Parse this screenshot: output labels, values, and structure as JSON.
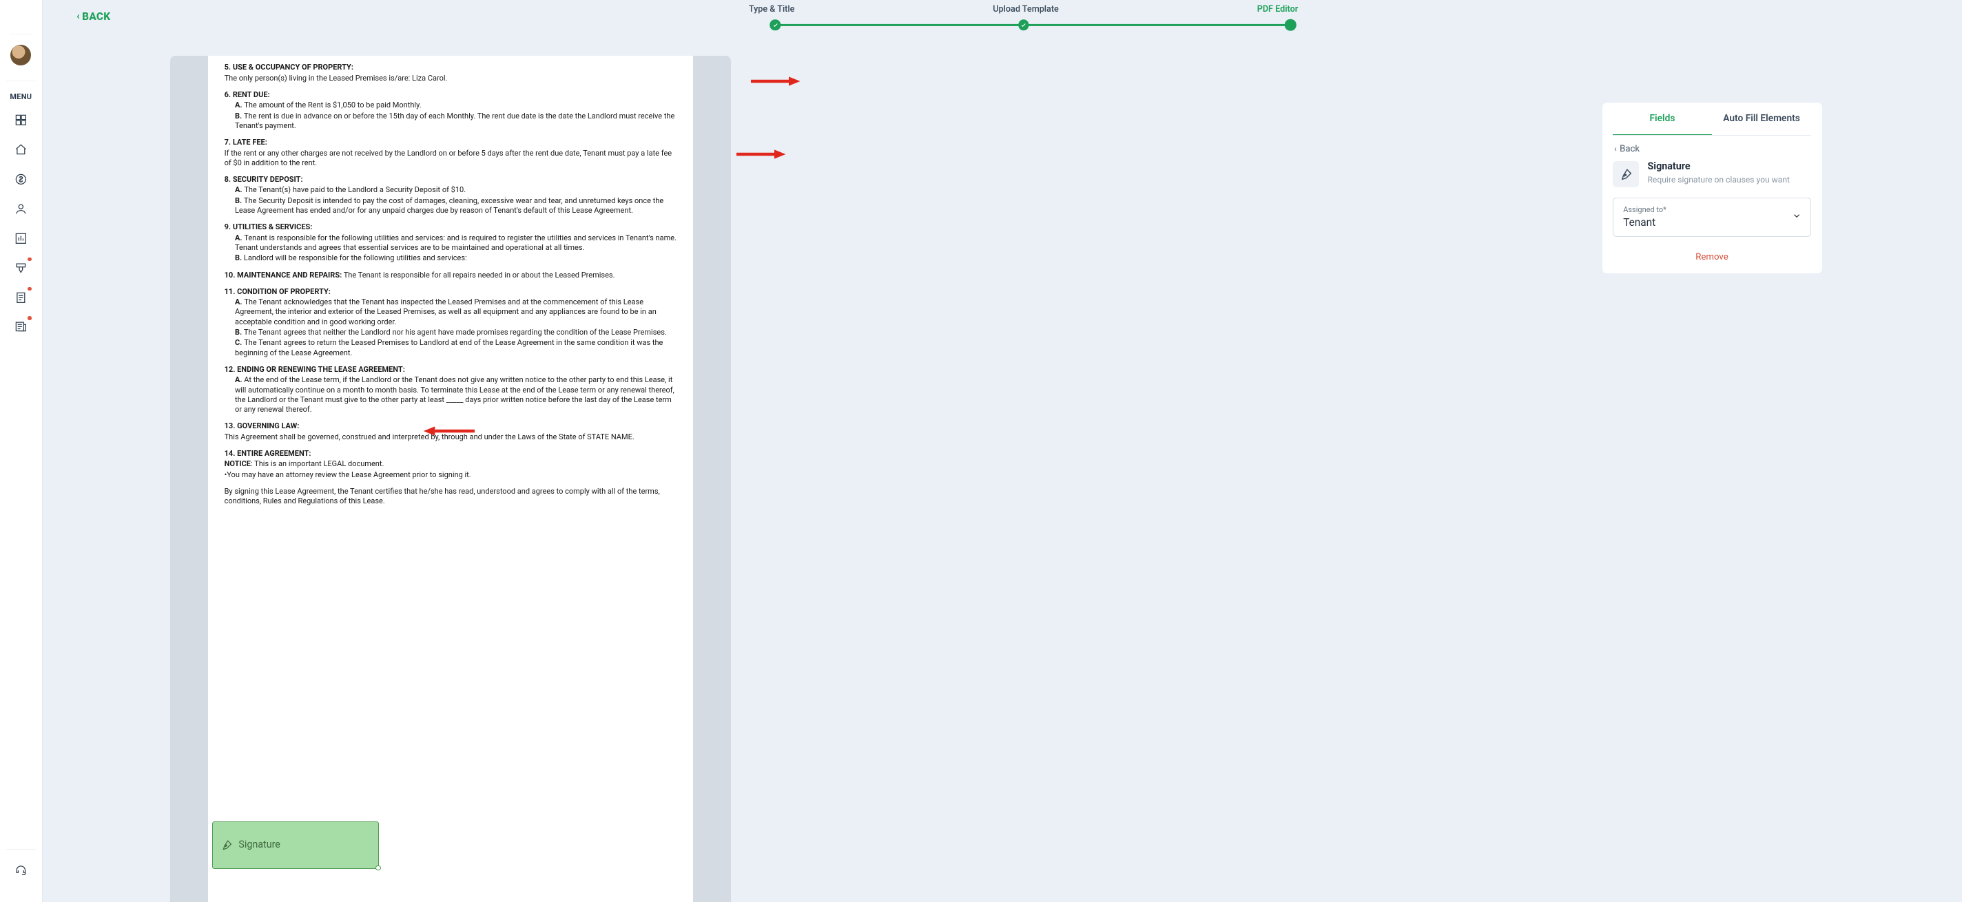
{
  "sidebar": {
    "menu_label": "MENU",
    "items": [
      {
        "name": "dashboard-icon"
      },
      {
        "name": "home-icon"
      },
      {
        "name": "money-icon"
      },
      {
        "name": "person-icon"
      },
      {
        "name": "chart-icon"
      },
      {
        "name": "brush-icon",
        "dot": true
      },
      {
        "name": "document-icon",
        "dot": true
      },
      {
        "name": "news-icon",
        "dot": true
      }
    ],
    "footer_icon": "headset-icon"
  },
  "header": {
    "back_label": "BACK",
    "steps": [
      "Type & Title",
      "Upload Template",
      "PDF Editor"
    ],
    "active_step_index": 2
  },
  "document": {
    "sec5_title": "5. USE & OCCUPANCY OF PROPERTY:",
    "sec5_body": "The only person(s) living in the Leased Premises is/are: Liza Carol.",
    "sec6_title": "6. RENT DUE:",
    "sec6_a": "The amount of the Rent is $1,050 to be paid Monthly.",
    "sec6_b": "The rent is due in advance on or before the 15th day of each Monthly. The rent due date is the date the Landlord must receive the Tenant's payment.",
    "sec7_title": "7. LATE FEE:",
    "sec7_body": "If the rent or any other charges are not received by the Landlord on or before 5 days after the rent due date, Tenant must pay a late fee of  $0 in addition to the rent.",
    "sec8_title": "8. SECURITY DEPOSIT:",
    "sec8_a": "The Tenant(s) have paid to the Landlord a Security Deposit of $10.",
    "sec8_b": "The Security Deposit is intended to pay the cost of damages, cleaning, excessive wear and tear, and unreturned keys once the Lease Agreement has ended and/or for any unpaid charges due by reason of Tenant's default of this Lease Agreement.",
    "sec9_title": "9. UTILITIES & SERVICES:",
    "sec9_a": "Tenant is responsible for the following utilities and services:  and is required to register the utilities and services in Tenant's name. Tenant understands and agrees that essential services are to be maintained and operational at all times.",
    "sec9_b": "Landlord will be responsible for the following utilities and services:",
    "sec10_title": "10. MAINTENANCE AND REPAIRS:",
    "sec10_body": "The Tenant is responsible for all repairs needed in or about the Leased Premises.",
    "sec11_title": "11. CONDITION OF PROPERTY:",
    "sec11_a": "The Tenant acknowledges that the Tenant has inspected the Leased Premises and at the commencement of this Lease Agreement, the interior and exterior of the Leased Premises, as well as all equipment and any appliances are found to be in an acceptable condition and in good working order.",
    "sec11_b": "The Tenant agrees that neither the Landlord nor his agent have made promises regarding the condition of the Lease Premises.",
    "sec11_c": "The Tenant agrees to return the Leased Premises to Landlord at end of the Lease Agreement in the same condition it was the beginning of the Lease Agreement.",
    "sec12_title": "12. ENDING OR RENEWING THE LEASE AGREEMENT:",
    "sec12_a": "At the end of the Lease term, if the Landlord or the Tenant does not give any written notice to the other party to end this Lease, it will automatically continue on a month to month basis. To terminate this Lease at the end of the Lease term or any renewal thereof, the Landlord or the Tenant must give to the other party at least _____ days prior written notice before the last day of the Lease term or any renewal thereof.",
    "sec13_title": "13. GOVERNING LAW:",
    "sec13_body": "This Agreement shall be governed, construed and interpreted by, through and under the Laws of the State of STATE NAME.",
    "sec14_title": "14. ENTIRE AGREEMENT:",
    "sec14_notice_label": "NOTICE",
    "sec14_notice": ": This is an important LEGAL document.",
    "sec14_bullet": "•You may have an attorney review the Lease Agreement prior to signing it.",
    "sec_closing": "By signing this Lease Agreement, the Tenant certifies that he/she has read, understood and agrees to comply with all of the terms, conditions, Rules and Regulations of this Lease.",
    "sig_field_label": "Signature"
  },
  "panel": {
    "tabs": [
      "Fields",
      "Auto Fill Elements"
    ],
    "active_tab": 0,
    "back_label": "Back",
    "sig_title": "Signature",
    "sig_desc": "Require signature on clauses you want",
    "assigned_label": "Assigned to*",
    "assigned_value": "Tenant",
    "remove_label": "Remove"
  }
}
